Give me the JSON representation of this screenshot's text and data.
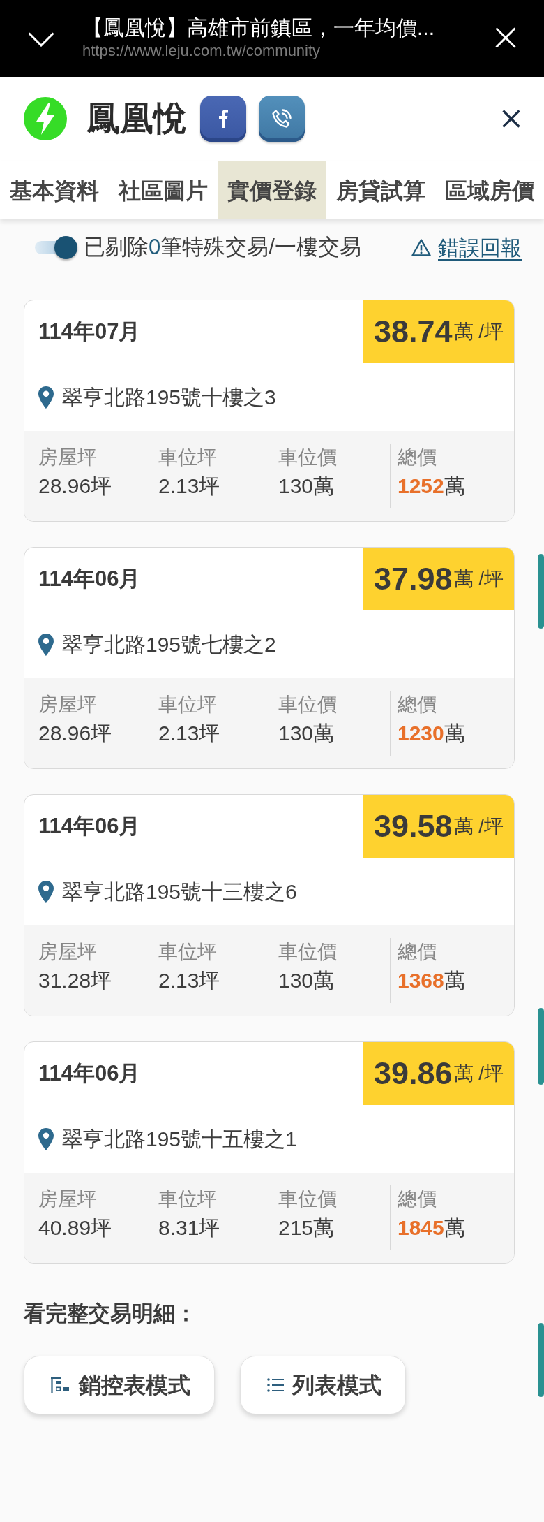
{
  "browser_bar": {
    "title": "【鳳凰悅】高雄市前鎮區，一年均價...",
    "url": "https://www.leju.com.tw/community"
  },
  "header": {
    "title": "鳳凰悅"
  },
  "tabs": [
    {
      "label": "基本資料",
      "selected": false
    },
    {
      "label": "社區圖片",
      "selected": false
    },
    {
      "label": "實價登錄",
      "selected": true
    },
    {
      "label": "房貸試算",
      "selected": false
    },
    {
      "label": "區域房價",
      "selected": false
    }
  ],
  "filter": {
    "on": true,
    "prefix": "已剔除",
    "count": "0",
    "suffix": "筆特殊交易/一樓交易"
  },
  "report_link": "錯誤回報",
  "transactions": [
    {
      "date": "114年07月",
      "price": "38.74",
      "price_unit": "萬 /坪",
      "address": "翠亨北路195號十樓之3",
      "stats": [
        {
          "kind": "plain",
          "label": "房屋坪",
          "value": "28.96坪"
        },
        {
          "kind": "plain",
          "label": "車位坪",
          "value": "2.13坪"
        },
        {
          "kind": "plain",
          "label": "車位價",
          "value": "130萬"
        },
        {
          "kind": "total",
          "label": "總價",
          "value": "1252",
          "unit": "萬"
        }
      ]
    },
    {
      "date": "114年06月",
      "price": "37.98",
      "price_unit": "萬 /坪",
      "address": "翠亨北路195號七樓之2",
      "stats": [
        {
          "kind": "plain",
          "label": "房屋坪",
          "value": "28.96坪"
        },
        {
          "kind": "plain",
          "label": "車位坪",
          "value": "2.13坪"
        },
        {
          "kind": "plain",
          "label": "車位價",
          "value": "130萬"
        },
        {
          "kind": "total",
          "label": "總價",
          "value": "1230",
          "unit": "萬"
        }
      ]
    },
    {
      "date": "114年06月",
      "price": "39.58",
      "price_unit": "萬 /坪",
      "address": "翠亨北路195號十三樓之6",
      "stats": [
        {
          "kind": "plain",
          "label": "房屋坪",
          "value": "31.28坪"
        },
        {
          "kind": "plain",
          "label": "車位坪",
          "value": "2.13坪"
        },
        {
          "kind": "plain",
          "label": "車位價",
          "value": "130萬"
        },
        {
          "kind": "total",
          "label": "總價",
          "value": "1368",
          "unit": "萬"
        }
      ]
    },
    {
      "date": "114年06月",
      "price": "39.86",
      "price_unit": "萬 /坪",
      "address": "翠亨北路195號十五樓之1",
      "stats": [
        {
          "kind": "plain",
          "label": "房屋坪",
          "value": "40.89坪"
        },
        {
          "kind": "plain",
          "label": "車位坪",
          "value": "8.31坪"
        },
        {
          "kind": "plain",
          "label": "車位價",
          "value": "215萬"
        },
        {
          "kind": "total",
          "label": "總價",
          "value": "1845",
          "unit": "萬"
        }
      ]
    }
  ],
  "details_heading": "看完整交易明細：",
  "view_buttons": [
    {
      "kind": "chart",
      "label": "銷控表模式"
    },
    {
      "kind": "list",
      "label": "列表模式"
    }
  ]
}
